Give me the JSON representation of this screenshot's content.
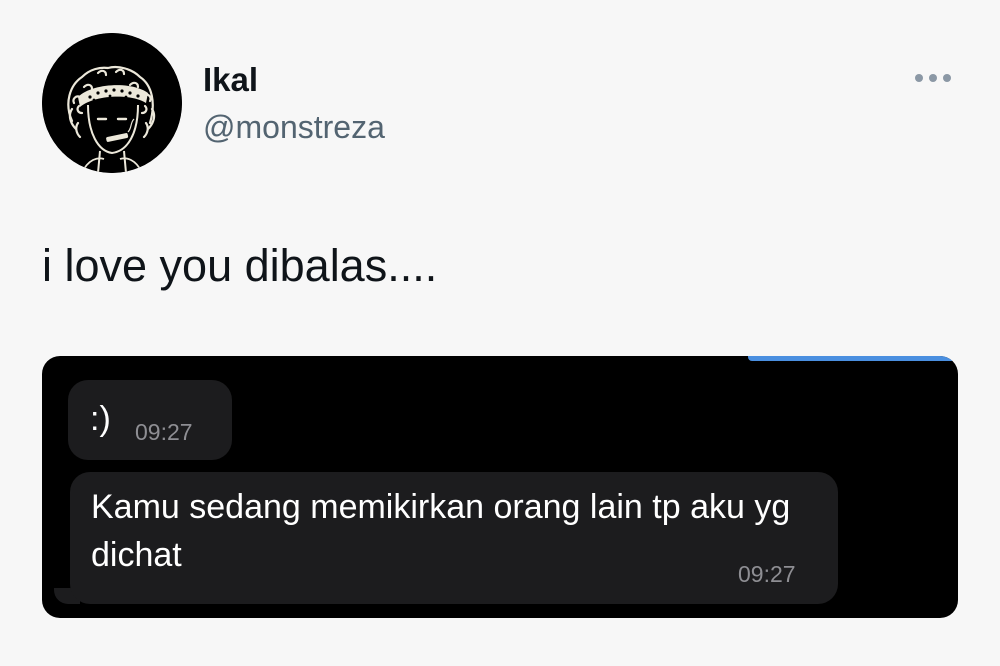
{
  "author": {
    "display_name": "Ikal",
    "handle": "@monstreza",
    "avatar_icon": "illustrated-face-avatar"
  },
  "more_icon": "more-horizontal-icon",
  "tweet": {
    "text": "i love you dibalas...."
  },
  "media": {
    "background": "#000000",
    "messages": [
      {
        "text": ":)",
        "time": "09:27"
      },
      {
        "text": "Kamu sedang memikirkan orang lain tp aku yg dichat",
        "time": "09:27"
      }
    ]
  },
  "colors": {
    "page_bg": "#f7f7f7",
    "text_primary": "#0f1419",
    "text_secondary": "#536471",
    "bubble_bg": "#1c1c1e",
    "timestamp": "#8e8e93",
    "accent": "#4a8fe0"
  }
}
